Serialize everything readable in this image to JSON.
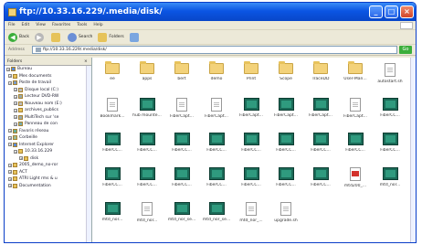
{
  "window": {
    "title": "ftp://10.33.16.229/.media/disk/"
  },
  "menubar": {
    "items": [
      "File",
      "Edit",
      "View",
      "Favorites",
      "Tools",
      "Help"
    ]
  },
  "toolbar": {
    "back": "Back",
    "search": "Search",
    "folders": "Folders"
  },
  "address": {
    "label": "Address",
    "value": "ftp://10.33.16.229/.media/disk/",
    "go": "Go"
  },
  "sidebar": {
    "title": "Folders",
    "items": [
      "Bureau",
      "Mes documents",
      "Poste de travail",
      "Disque local (C:)",
      "Lecteur DVD-RW",
      "Nouveau nom (E:)",
      "archives_publics",
      "MultiTech sur 'se",
      "Panneau de con",
      "Favoris réseau",
      "Corbeille",
      "Internet Explorer",
      "10.33.16.229",
      "disk",
      "2005_demo_no-ror",
      "ACT",
      "ATRI Light rms & u",
      "Documentation"
    ]
  },
  "files": [
    {
      "name": "ee",
      "type": "folder"
    },
    {
      "name": "apps",
      "type": "folder"
    },
    {
      "name": "bert",
      "type": "folder"
    },
    {
      "name": "demo",
      "type": "folder"
    },
    {
      "name": "Print",
      "type": "folder"
    },
    {
      "name": "Scope",
      "type": "folder"
    },
    {
      "name": "TraceDD",
      "type": "folder"
    },
    {
      "name": "User-Man...",
      "type": "folder"
    },
    {
      "name": "autostart.sh",
      "type": "doc"
    },
    {
      "name": "Bookmark...",
      "type": "doc"
    },
    {
      "name": "hub mounte...",
      "type": "mov"
    },
    {
      "name": "FiberCapt...",
      "type": "doc"
    },
    {
      "name": "FiberCapt...",
      "type": "doc"
    },
    {
      "name": "FiberCapt...",
      "type": "mov"
    },
    {
      "name": "FiberCapt...",
      "type": "mov"
    },
    {
      "name": "FiberCapt...",
      "type": "mov"
    },
    {
      "name": "FiberCapt...",
      "type": "doc"
    },
    {
      "name": "FiberCC...",
      "type": "mov"
    },
    {
      "name": "FiberCC...",
      "type": "mov"
    },
    {
      "name": "FiberCC...",
      "type": "mov"
    },
    {
      "name": "FiberCC...",
      "type": "mov"
    },
    {
      "name": "FiberCC...",
      "type": "mov"
    },
    {
      "name": "FiberCC...",
      "type": "mov"
    },
    {
      "name": "FiberCC...",
      "type": "mov"
    },
    {
      "name": "FiberCC...",
      "type": "mov"
    },
    {
      "name": "FiberCC...",
      "type": "mov"
    },
    {
      "name": "FiberCC...",
      "type": "mov"
    },
    {
      "name": "FiberCC...",
      "type": "mov"
    },
    {
      "name": "FiberCC...",
      "type": "mov"
    },
    {
      "name": "FiberCC...",
      "type": "mov"
    },
    {
      "name": "FiberCC...",
      "type": "mov"
    },
    {
      "name": "FiberCC...",
      "type": "mov"
    },
    {
      "name": "FiberCC...",
      "type": "mov"
    },
    {
      "name": "FiberCC...",
      "type": "mov"
    },
    {
      "name": "mtd200_...",
      "type": "pdf"
    },
    {
      "name": "mtd_nor...",
      "type": "mov"
    },
    {
      "name": "mtd_nor...",
      "type": "mov"
    },
    {
      "name": "mtd_nor...",
      "type": "doc"
    },
    {
      "name": "mtd_nor_se...",
      "type": "mov"
    },
    {
      "name": "mtd_nor_se...",
      "type": "mov"
    },
    {
      "name": "mtd_nor_...",
      "type": "doc"
    },
    {
      "name": "upgrade.sh",
      "type": "doc"
    }
  ]
}
